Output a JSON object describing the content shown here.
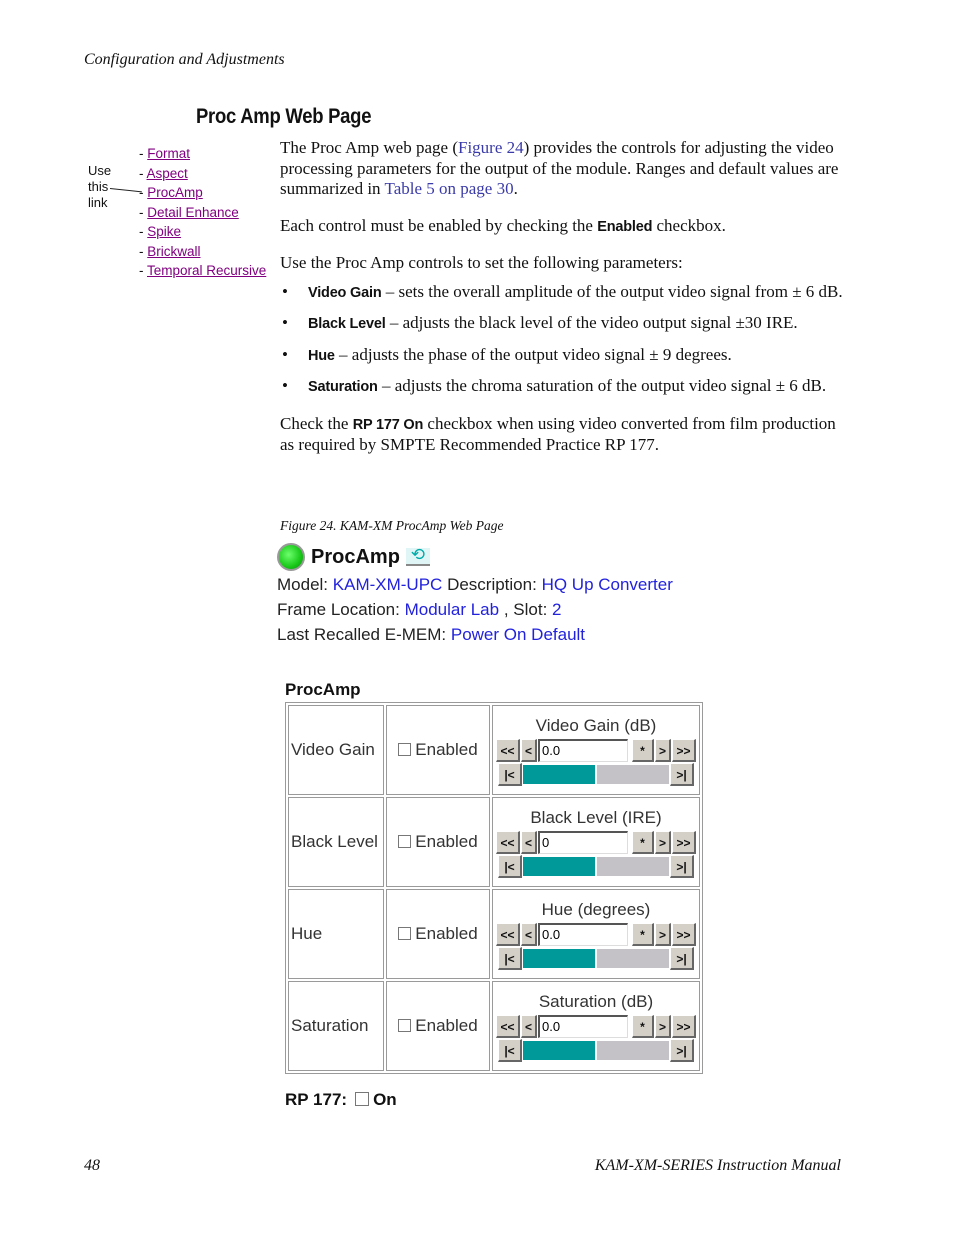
{
  "header": {
    "running_head": "Configuration and Adjustments",
    "section_title": "Proc Amp Web Page"
  },
  "nav": {
    "note_lines": [
      "Use",
      "this",
      "link"
    ],
    "items": [
      {
        "label": "Format"
      },
      {
        "label": "Aspect"
      },
      {
        "label": "ProcAmp"
      },
      {
        "label": "Detail Enhance"
      },
      {
        "label": "Spike"
      },
      {
        "label": "Brickwall"
      },
      {
        "label": "Temporal Recursive"
      }
    ]
  },
  "body": {
    "p1": {
      "a": "The Proc Amp web page (",
      "link1": "Figure 24",
      "b": ") provides the controls for adjusting the video processing parameters for the output of the module. Ranges and default values are summarized in ",
      "link2": "Table 5 on page 30",
      "c": "."
    },
    "p2": {
      "a": "Each control must be enabled by checking the ",
      "kw": "Enabled",
      "b": " checkbox."
    },
    "p3": "Use the Proc Amp controls to set the following parameters:",
    "bullets": [
      {
        "term": "Video Gain",
        "text": " – sets the overall amplitude of the output video signal from ± 6 dB."
      },
      {
        "term": "Black Level",
        "text": " – adjusts the black level of the video output signal ±30 IRE."
      },
      {
        "term": "Hue",
        "text": " – adjusts the phase of the output video signal ± 9 degrees."
      },
      {
        "term": "Saturation",
        "text": " – adjusts the chroma saturation of the output video signal ± 6 dB."
      }
    ],
    "p4": {
      "a": "Check the ",
      "kw": "RP 177 On",
      "b": " checkbox when using video converted from film production as required by SMPTE Recommended Practice RP 177."
    }
  },
  "figure": {
    "caption": "Figure 24.  KAM-XM ProcAmp Web Page",
    "title": "ProcAmp",
    "model_label": "Model:",
    "model": "KAM-XM-UPC",
    "description_label": "Description:",
    "description": "HQ Up Converter",
    "frame_label": "Frame Location:",
    "frame": "Modular Lab",
    "slot_label": ", Slot:",
    "slot": "2",
    "emem_label": "Last Recalled E-MEM:",
    "emem": "Power On Default",
    "table_heading": "ProcAmp",
    "enabled_label": "Enabled",
    "buttons": {
      "fast_back": "<<",
      "back": "<",
      "default": "*",
      "fwd": ">",
      "fast_fwd": ">>",
      "min": "|<",
      "max": ">|"
    },
    "rows": [
      {
        "name": "Video Gain",
        "control_title": "Video Gain (dB)",
        "value": "0.0",
        "enabled": false,
        "slider_fraction": 0.5
      },
      {
        "name": "Black Level",
        "control_title": "Black Level (IRE)",
        "value": "0",
        "enabled": false,
        "slider_fraction": 0.5
      },
      {
        "name": "Hue",
        "control_title": "Hue (degrees)",
        "value": "0.0",
        "enabled": false,
        "slider_fraction": 0.5
      },
      {
        "name": "Saturation",
        "control_title": "Saturation (dB)",
        "value": "0.0",
        "enabled": false,
        "slider_fraction": 0.5
      }
    ],
    "rp177_label": "RP 177:",
    "rp177_on_label": "On",
    "rp177_checked": false
  },
  "footer": {
    "page_number": "48",
    "manual_title": "KAM-XM-SERIES Instruction Manual"
  }
}
